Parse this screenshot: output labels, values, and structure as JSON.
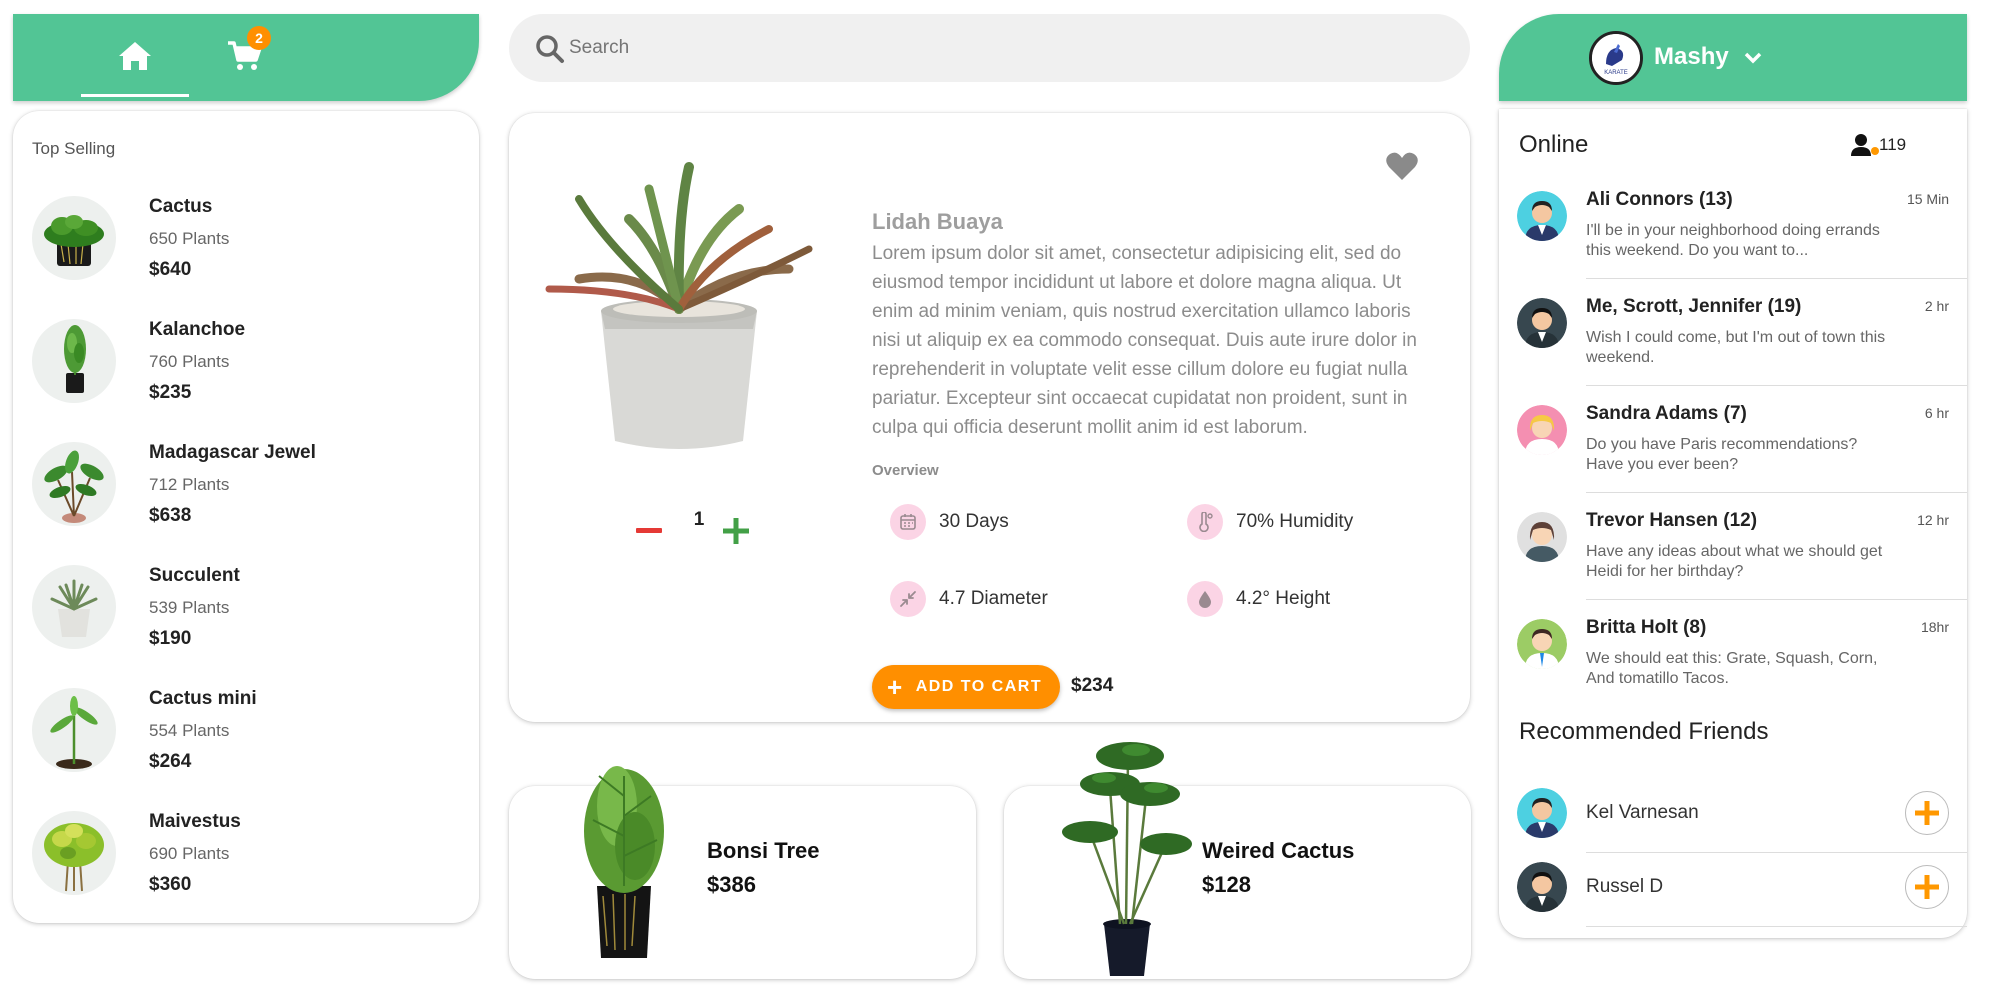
{
  "nav": {
    "home_icon": "home-icon",
    "cart_icon": "shopping-cart-icon",
    "cart_badge": "2",
    "accent": "#52c595"
  },
  "top_selling": {
    "title": "Top Selling",
    "items": [
      {
        "name": "Cactus",
        "count": "650 Plants",
        "price": "$640"
      },
      {
        "name": "Kalanchoe",
        "count": "760 Plants",
        "price": "$235"
      },
      {
        "name": "Madagascar Jewel",
        "count": "712 Plants",
        "price": "$638"
      },
      {
        "name": "Succulent",
        "count": "539 Plants",
        "price": "$190"
      },
      {
        "name": "Cactus mini",
        "count": "554 Plants",
        "price": "$264"
      },
      {
        "name": "Maivestus",
        "count": "690 Plants",
        "price": "$360"
      }
    ]
  },
  "search": {
    "placeholder": "Search",
    "icon": "search-icon"
  },
  "product": {
    "name": "Lidah Buaya",
    "description": "Lorem ipsum dolor sit amet, consectetur adipisicing elit, sed do eiusmod tempor incididunt ut labore et dolore magna aliqua. Ut enim ad minim veniam, quis nostrud exercitation ullamco laboris nisi ut aliquip ex ea commodo consequat. Duis aute irure dolor in reprehenderit in voluptate velit esse cillum dolore eu fugiat nulla pariatur. Excepteur sint occaecat cupidatat non proident, sunt in culpa qui officia deserunt mollit anim id est laborum.",
    "overview_label": "Overview",
    "overview": [
      {
        "icon": "calendar-icon",
        "text": "30 Days"
      },
      {
        "icon": "thermometer-icon",
        "text": "70% Humidity"
      },
      {
        "icon": "compress-arrows-icon",
        "text": "4.7 Diameter"
      },
      {
        "icon": "water-drop-icon",
        "text": "4.2° Height"
      }
    ],
    "quantity": "1",
    "add_to_cart_label": "ADD TO CART",
    "price": "$234",
    "accent": "#ff8f00"
  },
  "recommended_products": [
    {
      "name": "Bonsi Tree",
      "price": "$386"
    },
    {
      "name": "Weired Cactus",
      "price": "$128"
    }
  ],
  "user": {
    "name": "Mashy"
  },
  "online": {
    "title": "Online",
    "count": "119",
    "messages": [
      {
        "name": "Ali Connors (13)",
        "time": "15 Min",
        "text": "I'll be in your neighborhood doing errands this weekend. Do you want to..."
      },
      {
        "name": "Me, Scrott, Jennifer (19)",
        "time": "2 hr",
        "text": "Wish I could come, but I'm out of town this weekend."
      },
      {
        "name": "Sandra Adams (7)",
        "time": "6 hr",
        "text": "Do you have Paris recommendations? Have you ever been?"
      },
      {
        "name": "Trevor Hansen (12)",
        "time": "12 hr",
        "text": "Have any ideas about what we should get Heidi for her birthday?"
      },
      {
        "name": "Britta Holt (8)",
        "time": "18hr",
        "text": "We should eat this: Grate, Squash, Corn, And tomatillo Tacos."
      }
    ]
  },
  "recommended_friends": {
    "title": "Recommended Friends",
    "friends": [
      {
        "name": "Kel Varnesan"
      },
      {
        "name": "Russel D"
      }
    ]
  }
}
